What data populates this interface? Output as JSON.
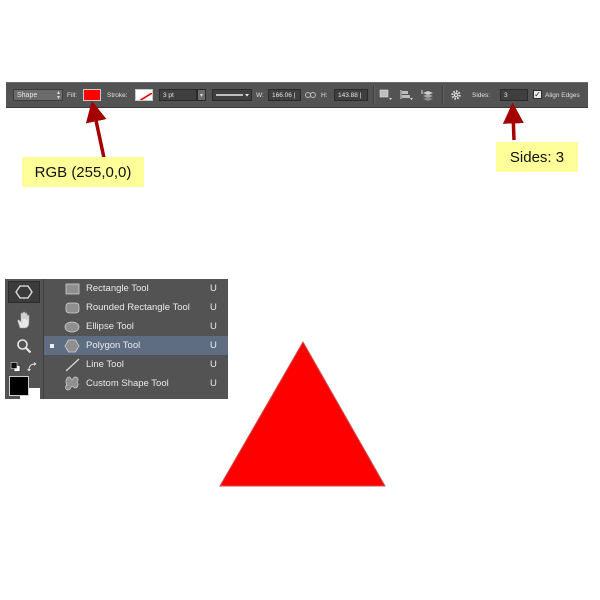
{
  "options_bar": {
    "mode": "Shape",
    "fill_label": "Fill:",
    "fill_color": "#ff0000",
    "stroke_label": "Stroke:",
    "stroke_width": "3 pt",
    "width_label": "W:",
    "width_value": "166.06 |",
    "height_label": "H:",
    "height_value": "143.88 |",
    "sides_label": "Sides:",
    "sides_value": "3",
    "align_edges_label": "Align Edges",
    "align_edges_checked": true
  },
  "callouts": {
    "rgb": "RGB (255,0,0)",
    "sides": "Sides: 3"
  },
  "tools_flyout": {
    "items": [
      {
        "label": "Rectangle Tool",
        "key": "U",
        "icon": "rectangle-icon",
        "selected": false
      },
      {
        "label": "Rounded Rectangle Tool",
        "key": "U",
        "icon": "rounded-rectangle-icon",
        "selected": false
      },
      {
        "label": "Ellipse Tool",
        "key": "U",
        "icon": "ellipse-icon",
        "selected": false
      },
      {
        "label": "Polygon Tool",
        "key": "U",
        "icon": "polygon-icon",
        "selected": true
      },
      {
        "label": "Line Tool",
        "key": "U",
        "icon": "line-icon",
        "selected": false
      },
      {
        "label": "Custom Shape Tool",
        "key": "U",
        "icon": "custom-shape-icon",
        "selected": false
      }
    ]
  },
  "colors": {
    "arrow": "#a50000",
    "triangle": "#ff0000",
    "callout_bg": "#ffff99",
    "toolbar_bg": "#535353"
  }
}
